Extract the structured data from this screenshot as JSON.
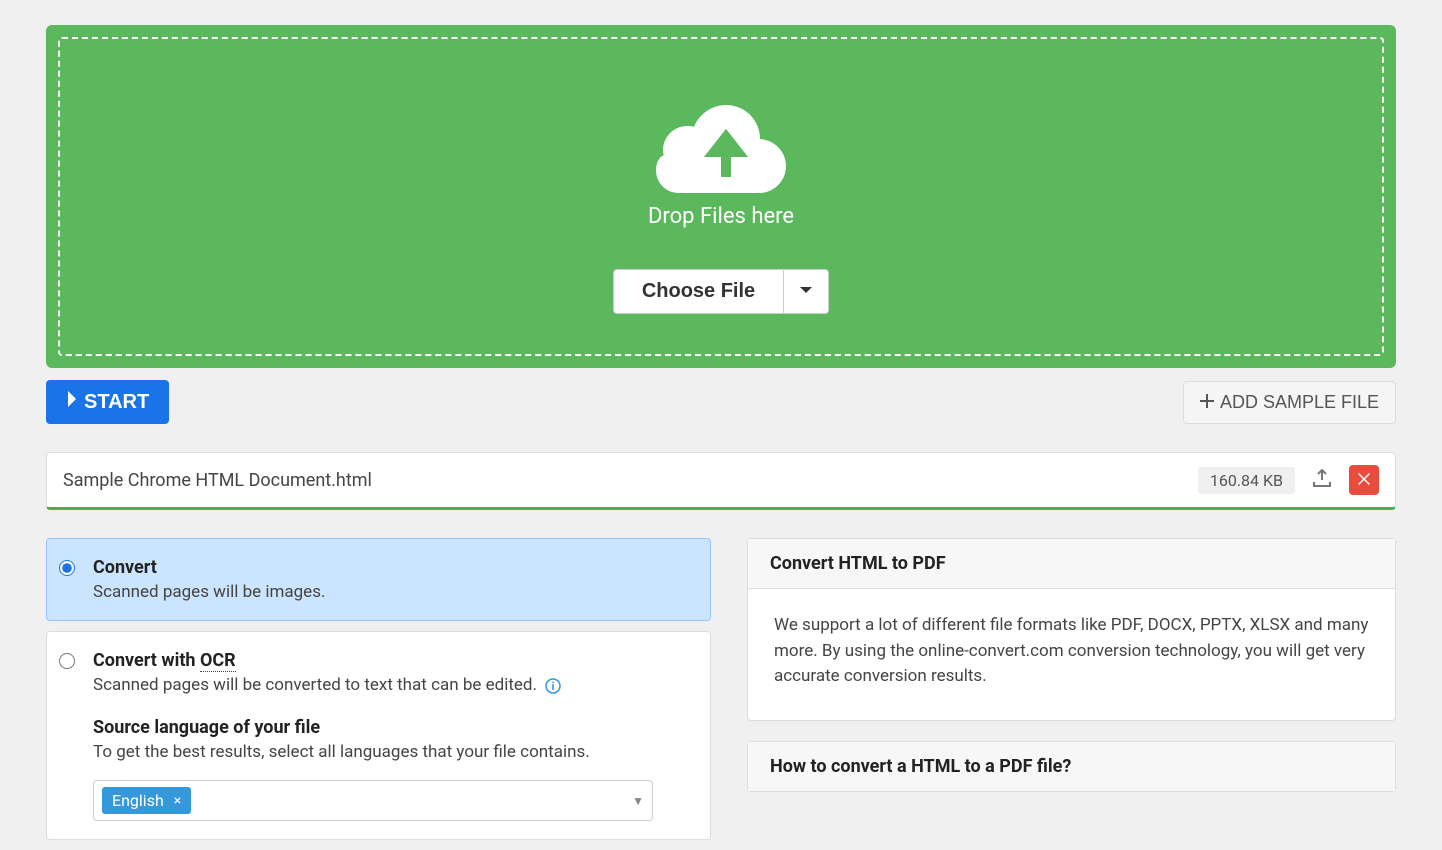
{
  "dropzone": {
    "text": "Drop Files here",
    "chooseFile": "Choose File"
  },
  "actions": {
    "start": "START",
    "addSample": "ADD SAMPLE FILE"
  },
  "file": {
    "name": "Sample Chrome HTML Document.html",
    "size": "160.84 KB"
  },
  "options": {
    "convert": {
      "title": "Convert",
      "sub": "Scanned pages will be images."
    },
    "convertOcr": {
      "titlePrefix": "Convert with ",
      "titleOcr": "OCR",
      "sub": "Scanned pages will be converted to text that can be edited.",
      "sourceLabel": "Source language of your file",
      "sourceSub": "To get the best results, select all languages that your file contains.",
      "language": "English"
    }
  },
  "panels": {
    "convertTitle": "Convert HTML to PDF",
    "convertBody": "We support a lot of different file formats like PDF, DOCX, PPTX, XLSX and many more. By using the online-convert.com conversion technology, you will get very accurate conversion results.",
    "howtoTitle": "How to convert a HTML to a PDF file?"
  }
}
